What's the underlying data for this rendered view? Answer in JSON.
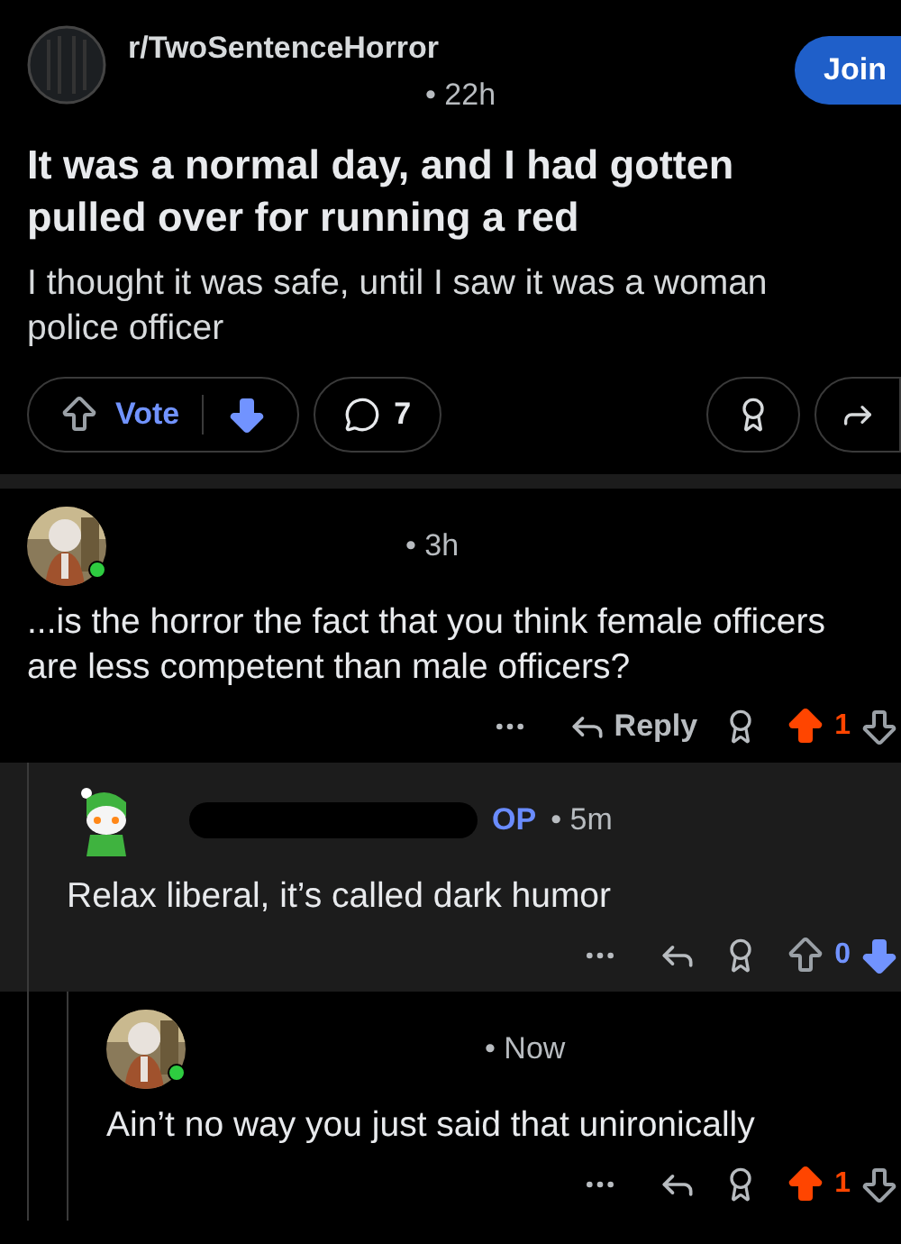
{
  "post": {
    "subreddit": "r/TwoSentenceHorror",
    "time": "• 22h",
    "join_label": "Join",
    "title": "It was a normal day, and I had gotten pulled over for running a red",
    "body": "I thought it was safe, until I saw it was a woman police officer",
    "vote_label": "Vote",
    "upvoted": false,
    "downvoted": true,
    "comment_count": "7"
  },
  "comments": [
    {
      "avatar": {
        "kind": "picture",
        "online": true
      },
      "redacted_name": false,
      "time": "• 3h",
      "text": "...is the horror the fact that you think female officers are less competent than male officers?",
      "reply_label": "Reply",
      "upvoted": true,
      "downvoted": false,
      "score": "1",
      "children": [
        {
          "avatar": {
            "kind": "snoo",
            "online": false
          },
          "redacted_name": true,
          "op_badge": "OP",
          "time": "• 5m",
          "text": "Relax liberal, it’s called dark humor",
          "upvoted": false,
          "downvoted": true,
          "score": "0",
          "children": [
            {
              "avatar": {
                "kind": "picture",
                "online": true
              },
              "redacted_name": false,
              "time": "• Now",
              "text": "Ain’t no way you just said that unironically",
              "upvoted": true,
              "downvoted": false,
              "score": "1"
            }
          ]
        }
      ]
    }
  ]
}
